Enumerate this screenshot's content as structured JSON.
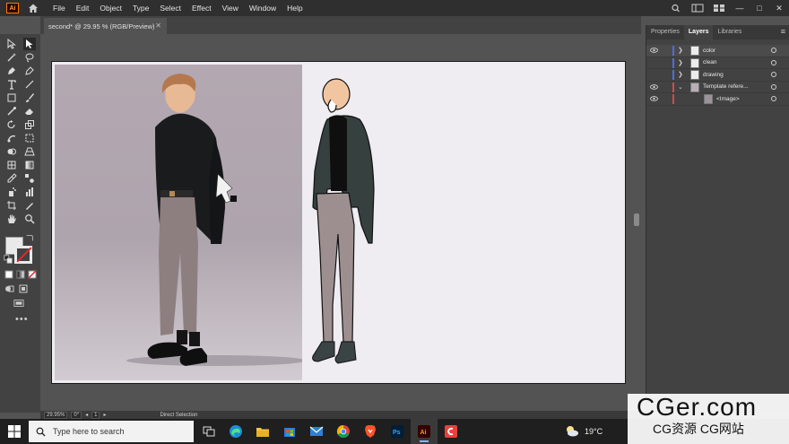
{
  "app": {
    "logo_text": "Ai"
  },
  "menu": [
    "File",
    "Edit",
    "Object",
    "Type",
    "Select",
    "Effect",
    "View",
    "Window",
    "Help"
  ],
  "window_controls": [
    "—",
    "□",
    "✕"
  ],
  "document_tab": {
    "title": "second* @ 29.95 % (RGB/Preview)",
    "close": "✕"
  },
  "panel": {
    "tabs": [
      "Properties",
      "Layers",
      "Libraries"
    ],
    "active_tab": "Layers",
    "layers": [
      {
        "name": "color",
        "visible": true,
        "color": "#4b6fe0",
        "selected": true
      },
      {
        "name": "clean",
        "visible": false,
        "color": "#4b6fe0"
      },
      {
        "name": "drawing",
        "visible": false,
        "color": "#4b6fe0"
      },
      {
        "name": "Template refere...",
        "visible": true,
        "color": "#d24a4a",
        "expanded": true
      },
      {
        "name": "<Image>",
        "visible": true,
        "color": "#d24a4a",
        "sublayer": true
      }
    ]
  },
  "status": {
    "zoom": "29.95%",
    "rotation": "0°",
    "artboard": "1",
    "tool": "Direct Selection"
  },
  "taskbar": {
    "search_placeholder": "Type here to search",
    "apps": [
      "task-view",
      "edge",
      "file-explorer",
      "store",
      "mail",
      "chrome",
      "brave",
      "photoshop",
      "illustrator",
      "clip-studio"
    ],
    "temperature": "19°C"
  },
  "watermark": {
    "title": "CGer.com",
    "subtitle": "CG资源 CG网站"
  },
  "colors": {
    "accent": "#ff7a00",
    "layer_blue": "#4b6fe0",
    "layer_red": "#d24a4a",
    "jacket": "#35403f",
    "pants": "#9d8f90",
    "skin": "#f2c5a1"
  }
}
